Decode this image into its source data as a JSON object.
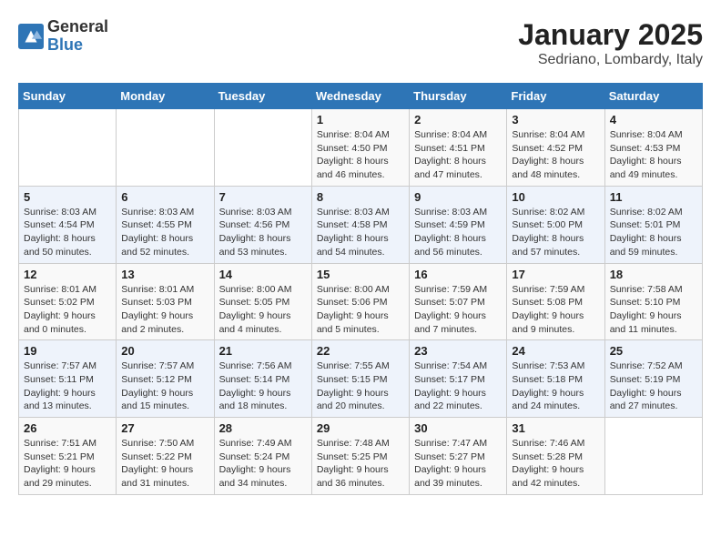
{
  "logo": {
    "general": "General",
    "blue": "Blue"
  },
  "title": "January 2025",
  "subtitle": "Sedriano, Lombardy, Italy",
  "weekdays": [
    "Sunday",
    "Monday",
    "Tuesday",
    "Wednesday",
    "Thursday",
    "Friday",
    "Saturday"
  ],
  "weeks": [
    [
      {
        "day": "",
        "info": ""
      },
      {
        "day": "",
        "info": ""
      },
      {
        "day": "",
        "info": ""
      },
      {
        "day": "1",
        "info": "Sunrise: 8:04 AM\nSunset: 4:50 PM\nDaylight: 8 hours and 46 minutes."
      },
      {
        "day": "2",
        "info": "Sunrise: 8:04 AM\nSunset: 4:51 PM\nDaylight: 8 hours and 47 minutes."
      },
      {
        "day": "3",
        "info": "Sunrise: 8:04 AM\nSunset: 4:52 PM\nDaylight: 8 hours and 48 minutes."
      },
      {
        "day": "4",
        "info": "Sunrise: 8:04 AM\nSunset: 4:53 PM\nDaylight: 8 hours and 49 minutes."
      }
    ],
    [
      {
        "day": "5",
        "info": "Sunrise: 8:03 AM\nSunset: 4:54 PM\nDaylight: 8 hours and 50 minutes."
      },
      {
        "day": "6",
        "info": "Sunrise: 8:03 AM\nSunset: 4:55 PM\nDaylight: 8 hours and 52 minutes."
      },
      {
        "day": "7",
        "info": "Sunrise: 8:03 AM\nSunset: 4:56 PM\nDaylight: 8 hours and 53 minutes."
      },
      {
        "day": "8",
        "info": "Sunrise: 8:03 AM\nSunset: 4:58 PM\nDaylight: 8 hours and 54 minutes."
      },
      {
        "day": "9",
        "info": "Sunrise: 8:03 AM\nSunset: 4:59 PM\nDaylight: 8 hours and 56 minutes."
      },
      {
        "day": "10",
        "info": "Sunrise: 8:02 AM\nSunset: 5:00 PM\nDaylight: 8 hours and 57 minutes."
      },
      {
        "day": "11",
        "info": "Sunrise: 8:02 AM\nSunset: 5:01 PM\nDaylight: 8 hours and 59 minutes."
      }
    ],
    [
      {
        "day": "12",
        "info": "Sunrise: 8:01 AM\nSunset: 5:02 PM\nDaylight: 9 hours and 0 minutes."
      },
      {
        "day": "13",
        "info": "Sunrise: 8:01 AM\nSunset: 5:03 PM\nDaylight: 9 hours and 2 minutes."
      },
      {
        "day": "14",
        "info": "Sunrise: 8:00 AM\nSunset: 5:05 PM\nDaylight: 9 hours and 4 minutes."
      },
      {
        "day": "15",
        "info": "Sunrise: 8:00 AM\nSunset: 5:06 PM\nDaylight: 9 hours and 5 minutes."
      },
      {
        "day": "16",
        "info": "Sunrise: 7:59 AM\nSunset: 5:07 PM\nDaylight: 9 hours and 7 minutes."
      },
      {
        "day": "17",
        "info": "Sunrise: 7:59 AM\nSunset: 5:08 PM\nDaylight: 9 hours and 9 minutes."
      },
      {
        "day": "18",
        "info": "Sunrise: 7:58 AM\nSunset: 5:10 PM\nDaylight: 9 hours and 11 minutes."
      }
    ],
    [
      {
        "day": "19",
        "info": "Sunrise: 7:57 AM\nSunset: 5:11 PM\nDaylight: 9 hours and 13 minutes."
      },
      {
        "day": "20",
        "info": "Sunrise: 7:57 AM\nSunset: 5:12 PM\nDaylight: 9 hours and 15 minutes."
      },
      {
        "day": "21",
        "info": "Sunrise: 7:56 AM\nSunset: 5:14 PM\nDaylight: 9 hours and 18 minutes."
      },
      {
        "day": "22",
        "info": "Sunrise: 7:55 AM\nSunset: 5:15 PM\nDaylight: 9 hours and 20 minutes."
      },
      {
        "day": "23",
        "info": "Sunrise: 7:54 AM\nSunset: 5:17 PM\nDaylight: 9 hours and 22 minutes."
      },
      {
        "day": "24",
        "info": "Sunrise: 7:53 AM\nSunset: 5:18 PM\nDaylight: 9 hours and 24 minutes."
      },
      {
        "day": "25",
        "info": "Sunrise: 7:52 AM\nSunset: 5:19 PM\nDaylight: 9 hours and 27 minutes."
      }
    ],
    [
      {
        "day": "26",
        "info": "Sunrise: 7:51 AM\nSunset: 5:21 PM\nDaylight: 9 hours and 29 minutes."
      },
      {
        "day": "27",
        "info": "Sunrise: 7:50 AM\nSunset: 5:22 PM\nDaylight: 9 hours and 31 minutes."
      },
      {
        "day": "28",
        "info": "Sunrise: 7:49 AM\nSunset: 5:24 PM\nDaylight: 9 hours and 34 minutes."
      },
      {
        "day": "29",
        "info": "Sunrise: 7:48 AM\nSunset: 5:25 PM\nDaylight: 9 hours and 36 minutes."
      },
      {
        "day": "30",
        "info": "Sunrise: 7:47 AM\nSunset: 5:27 PM\nDaylight: 9 hours and 39 minutes."
      },
      {
        "day": "31",
        "info": "Sunrise: 7:46 AM\nSunset: 5:28 PM\nDaylight: 9 hours and 42 minutes."
      },
      {
        "day": "",
        "info": ""
      }
    ]
  ]
}
